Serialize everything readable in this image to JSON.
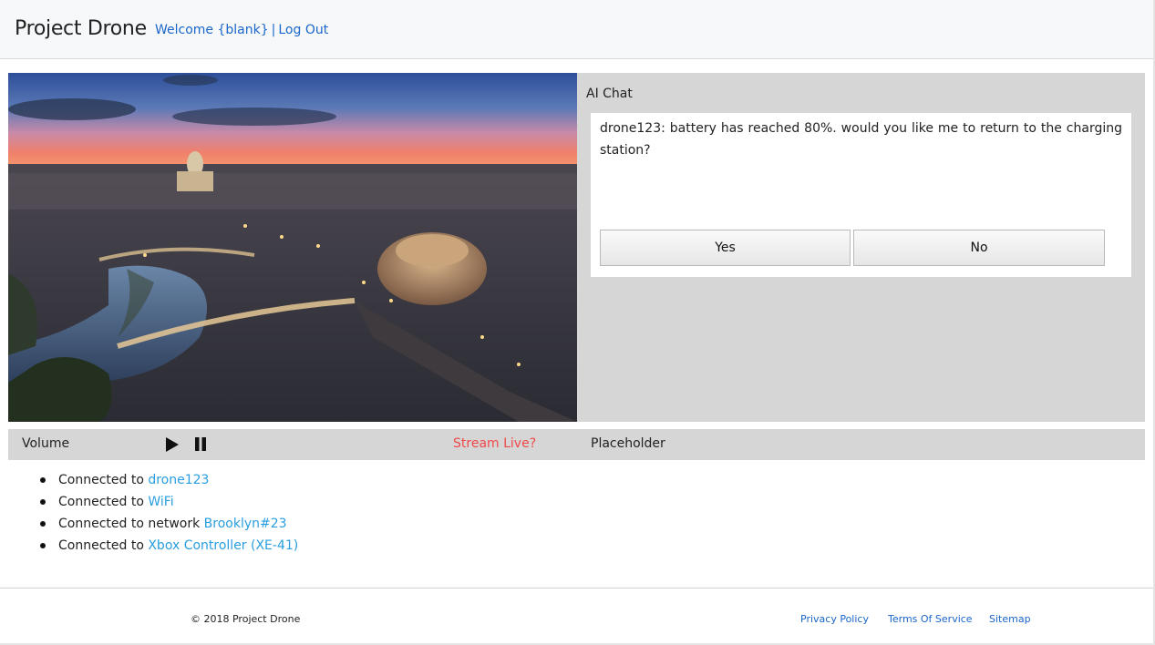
{
  "header": {
    "brand": "Project Drone",
    "welcome": "Welcome {blank}",
    "separator": "|",
    "logout": "Log Out"
  },
  "video": {
    "alt": "Aerial city view at dusk with river and bridges"
  },
  "chat": {
    "title": "AI Chat",
    "message": "drone123: battery has reached 80%. would you like me to return to the charging station?",
    "yes_label": "Yes",
    "no_label": "No"
  },
  "controls": {
    "volume_label": "Volume",
    "play_icon": "play-icon",
    "pause_icon": "pause-icon",
    "stream_label": "Stream Live?",
    "stream_color": "#f04848",
    "placeholder_label": "Placeholder"
  },
  "status": {
    "items": [
      {
        "prefix": "Connected to ",
        "value": "drone123"
      },
      {
        "prefix": "Connected to ",
        "value": "WiFi"
      },
      {
        "prefix": "Connected to network ",
        "value": "Brooklyn#23"
      },
      {
        "prefix": "Connected to ",
        "value": "Xbox Controller (XE-41)"
      }
    ],
    "value_color": "#2a9ee0"
  },
  "footer": {
    "copyright": "© 2018 Project Drone",
    "links": [
      "Privacy Policy",
      "Terms Of Service",
      "Sitemap"
    ]
  },
  "colors": {
    "link": "#1a66c9",
    "panel_bg": "#d6d6d6",
    "header_bg": "#f7f8fa"
  }
}
